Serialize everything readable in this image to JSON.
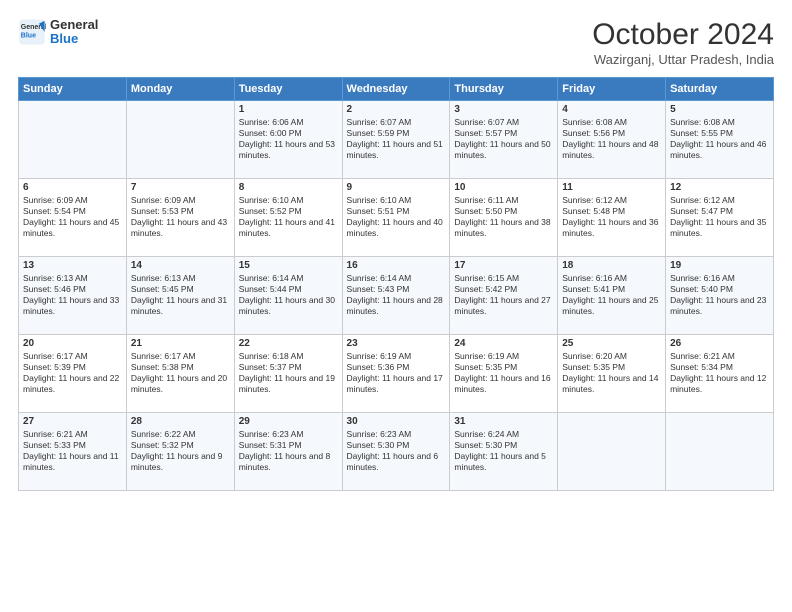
{
  "logo": {
    "line1": "General",
    "line2": "Blue"
  },
  "title": "October 2024",
  "location": "Wazirganj, Uttar Pradesh, India",
  "header_days": [
    "Sunday",
    "Monday",
    "Tuesday",
    "Wednesday",
    "Thursday",
    "Friday",
    "Saturday"
  ],
  "weeks": [
    [
      {
        "day": "",
        "content": ""
      },
      {
        "day": "",
        "content": ""
      },
      {
        "day": "1",
        "content": "Sunrise: 6:06 AM\nSunset: 6:00 PM\nDaylight: 11 hours and 53 minutes."
      },
      {
        "day": "2",
        "content": "Sunrise: 6:07 AM\nSunset: 5:59 PM\nDaylight: 11 hours and 51 minutes."
      },
      {
        "day": "3",
        "content": "Sunrise: 6:07 AM\nSunset: 5:57 PM\nDaylight: 11 hours and 50 minutes."
      },
      {
        "day": "4",
        "content": "Sunrise: 6:08 AM\nSunset: 5:56 PM\nDaylight: 11 hours and 48 minutes."
      },
      {
        "day": "5",
        "content": "Sunrise: 6:08 AM\nSunset: 5:55 PM\nDaylight: 11 hours and 46 minutes."
      }
    ],
    [
      {
        "day": "6",
        "content": "Sunrise: 6:09 AM\nSunset: 5:54 PM\nDaylight: 11 hours and 45 minutes."
      },
      {
        "day": "7",
        "content": "Sunrise: 6:09 AM\nSunset: 5:53 PM\nDaylight: 11 hours and 43 minutes."
      },
      {
        "day": "8",
        "content": "Sunrise: 6:10 AM\nSunset: 5:52 PM\nDaylight: 11 hours and 41 minutes."
      },
      {
        "day": "9",
        "content": "Sunrise: 6:10 AM\nSunset: 5:51 PM\nDaylight: 11 hours and 40 minutes."
      },
      {
        "day": "10",
        "content": "Sunrise: 6:11 AM\nSunset: 5:50 PM\nDaylight: 11 hours and 38 minutes."
      },
      {
        "day": "11",
        "content": "Sunrise: 6:12 AM\nSunset: 5:48 PM\nDaylight: 11 hours and 36 minutes."
      },
      {
        "day": "12",
        "content": "Sunrise: 6:12 AM\nSunset: 5:47 PM\nDaylight: 11 hours and 35 minutes."
      }
    ],
    [
      {
        "day": "13",
        "content": "Sunrise: 6:13 AM\nSunset: 5:46 PM\nDaylight: 11 hours and 33 minutes."
      },
      {
        "day": "14",
        "content": "Sunrise: 6:13 AM\nSunset: 5:45 PM\nDaylight: 11 hours and 31 minutes."
      },
      {
        "day": "15",
        "content": "Sunrise: 6:14 AM\nSunset: 5:44 PM\nDaylight: 11 hours and 30 minutes."
      },
      {
        "day": "16",
        "content": "Sunrise: 6:14 AM\nSunset: 5:43 PM\nDaylight: 11 hours and 28 minutes."
      },
      {
        "day": "17",
        "content": "Sunrise: 6:15 AM\nSunset: 5:42 PM\nDaylight: 11 hours and 27 minutes."
      },
      {
        "day": "18",
        "content": "Sunrise: 6:16 AM\nSunset: 5:41 PM\nDaylight: 11 hours and 25 minutes."
      },
      {
        "day": "19",
        "content": "Sunrise: 6:16 AM\nSunset: 5:40 PM\nDaylight: 11 hours and 23 minutes."
      }
    ],
    [
      {
        "day": "20",
        "content": "Sunrise: 6:17 AM\nSunset: 5:39 PM\nDaylight: 11 hours and 22 minutes."
      },
      {
        "day": "21",
        "content": "Sunrise: 6:17 AM\nSunset: 5:38 PM\nDaylight: 11 hours and 20 minutes."
      },
      {
        "day": "22",
        "content": "Sunrise: 6:18 AM\nSunset: 5:37 PM\nDaylight: 11 hours and 19 minutes."
      },
      {
        "day": "23",
        "content": "Sunrise: 6:19 AM\nSunset: 5:36 PM\nDaylight: 11 hours and 17 minutes."
      },
      {
        "day": "24",
        "content": "Sunrise: 6:19 AM\nSunset: 5:35 PM\nDaylight: 11 hours and 16 minutes."
      },
      {
        "day": "25",
        "content": "Sunrise: 6:20 AM\nSunset: 5:35 PM\nDaylight: 11 hours and 14 minutes."
      },
      {
        "day": "26",
        "content": "Sunrise: 6:21 AM\nSunset: 5:34 PM\nDaylight: 11 hours and 12 minutes."
      }
    ],
    [
      {
        "day": "27",
        "content": "Sunrise: 6:21 AM\nSunset: 5:33 PM\nDaylight: 11 hours and 11 minutes."
      },
      {
        "day": "28",
        "content": "Sunrise: 6:22 AM\nSunset: 5:32 PM\nDaylight: 11 hours and 9 minutes."
      },
      {
        "day": "29",
        "content": "Sunrise: 6:23 AM\nSunset: 5:31 PM\nDaylight: 11 hours and 8 minutes."
      },
      {
        "day": "30",
        "content": "Sunrise: 6:23 AM\nSunset: 5:30 PM\nDaylight: 11 hours and 6 minutes."
      },
      {
        "day": "31",
        "content": "Sunrise: 6:24 AM\nSunset: 5:30 PM\nDaylight: 11 hours and 5 minutes."
      },
      {
        "day": "",
        "content": ""
      },
      {
        "day": "",
        "content": ""
      }
    ]
  ]
}
